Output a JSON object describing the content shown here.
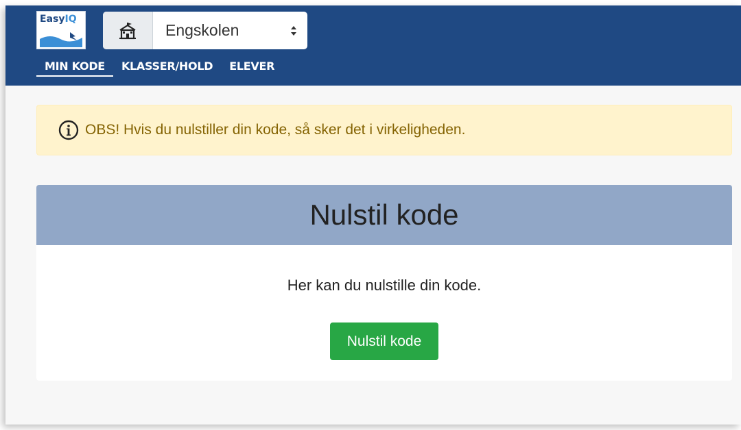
{
  "logo": {
    "brand_a": "Easy",
    "brand_b": "IQ"
  },
  "school_select": {
    "icon": "school-building-icon",
    "value": "Engskolen",
    "caret": "updown-caret-icon"
  },
  "nav": {
    "tabs": [
      {
        "label": "MIN KODE",
        "active": true
      },
      {
        "label": "KLASSER/HOLD",
        "active": false
      },
      {
        "label": "ELEVER",
        "active": false
      }
    ]
  },
  "alert": {
    "icon": "info-circle-icon",
    "text": "OBS! Hvis du nulstiller din kode, så sker det i virkeligheden."
  },
  "card": {
    "title": "Nulstil kode",
    "description": "Her kan du nulstille din kode.",
    "button_label": "Nulstil kode"
  },
  "colors": {
    "topbar": "#1f4983",
    "alert_bg": "#fff3cd",
    "alert_text": "#856404",
    "card_header": "#91a7c7",
    "button": "#28a745"
  }
}
